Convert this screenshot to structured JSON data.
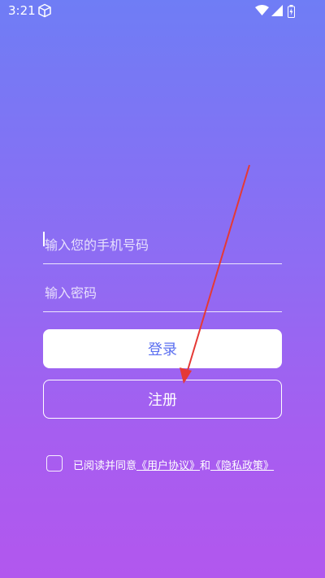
{
  "status_bar": {
    "time": "3:21",
    "icons": [
      "cube-icon",
      "wifi-icon",
      "signal-icon",
      "battery-icon"
    ]
  },
  "form": {
    "phone_placeholder": "输入您的手机号码",
    "password_placeholder": "输入密码"
  },
  "buttons": {
    "login_label": "登录",
    "register_label": "注册"
  },
  "agreement": {
    "prefix": "已阅读并同意",
    "user_agreement": "《用户协议》",
    "and": "和",
    "privacy_policy": "《隐私政策》"
  },
  "colors": {
    "gradient_top": "#6f7df5",
    "gradient_bottom": "#b257ee",
    "login_text": "#5b6ff0",
    "annotation_arrow": "#e53935"
  }
}
